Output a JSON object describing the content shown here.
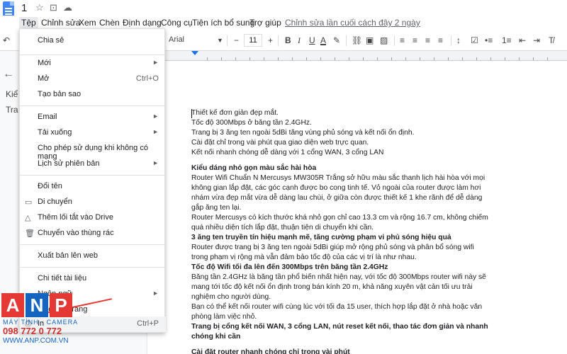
{
  "title_bar": {
    "doc_title": "1",
    "icons": [
      "star-icon",
      "move-to-folder-icon",
      "cloud-status-icon"
    ]
  },
  "menubar": {
    "items": [
      "Tệp",
      "Chỉnh sửa",
      "Xem",
      "Chèn",
      "Định dạng",
      "Công cụ",
      "Tiện ích bổ sung",
      "Trợ giúp"
    ],
    "last_edit": "Chỉnh sửa lần cuối cách đây 2 ngày"
  },
  "toolbar": {
    "font": "Arial",
    "font_size": "11",
    "minus": "−",
    "plus": "+",
    "bold": "B",
    "italic": "I",
    "underline": "U",
    "text_color": "A"
  },
  "outline": {
    "back": "←",
    "lines": [
      "Kiể",
      "Tra"
    ]
  },
  "file_menu": {
    "items": [
      {
        "label": "Chia sẻ"
      },
      {
        "label": "Mới",
        "arrow": "►"
      },
      {
        "label": "Mở",
        "shortcut": "Ctrl+O"
      },
      {
        "label": "Tạo bản sao"
      },
      {
        "label": "Email",
        "arrow": "►"
      },
      {
        "label": "Tải xuống",
        "arrow": "►"
      },
      {
        "label": "Cho phép sử dụng khi không có mạng"
      },
      {
        "label": "Lịch sử phiên bản",
        "arrow": "►"
      },
      {
        "label": "Đổi tên"
      },
      {
        "label": "Di chuyển"
      },
      {
        "label": "Thêm lối tắt vào Drive"
      },
      {
        "label": "Chuyển vào thùng rác"
      },
      {
        "label": "Xuất bản lên web"
      },
      {
        "label": "Chi tiết tài liệu"
      },
      {
        "label": "Ngôn ngữ",
        "arrow": "►"
      },
      {
        "label": "Thiết lập trang"
      },
      {
        "label": "In",
        "shortcut": "Ctrl+P"
      }
    ]
  },
  "document": {
    "lines": [
      "Thiết kế đơn giản đẹp mắt.",
      "Tốc độ 300Mbps ở băng tần 2.4GHz.",
      "Trang bị 3 ăng ten ngoài 5dBi tăng vùng phủ sóng và kết nối ổn định.",
      "Cài đặt chỉ trong vài phút qua giao diện web trực quan.",
      "Kết nối nhanh chóng dễ dàng với 1 cổng WAN, 3 cổng LAN",
      "Kiểu dáng nhỏ gọn màu sắc hài hòa",
      "Router Wifi Chuẩn N Mercusys MW305R Trắng sở hữu màu sắc thanh lịch hài hòa với mọi",
      "không gian lắp đặt, các góc cạnh được bo cong tinh tế. Vỏ ngoài của router được làm hơi",
      "nhám vừa đẹp mắt vừa dễ dàng lau chùi, ở giữa còn được thiết kế 1 khe rãnh để dễ dàng",
      "gắp ăng ten lại.",
      "Router Mercusys có kích thước khá nhỏ gọn chỉ cao 13.3 cm và rộng 16.7 cm, không chiếm",
      "quá nhiều diện tích lắp đặt, thuận tiện di chuyển khi cần.",
      "3 ăng ten truyền tín hiệu mạnh mẽ, tăng cường phạm vi phủ sóng hiệu quả",
      "Router được trang bị 3 ăng ten ngoài 5dBi giúp mở rộng phủ sóng và phân bổ sóng wifi",
      "trong phạm vị rộng mà vẫn đảm bảo tốc độ của các vị trí là như nhau.",
      "Tốc độ Wifi tối đa lên đến 300Mbps trên băng tần 2.4GHz",
      "Băng tần 2.4GHz là băng tần phổ biến nhất hiện nay, với tốc độ 300Mbps router wifi này sẽ",
      "mang tới tốc độ kết nối ổn định trong bán kính 20 m, khả năng xuyên vật cản tối ưu trải",
      "nghiệm cho người dùng.",
      "Bạn có thể kết nối router wifi cùng lúc với tối đa 15 user, thích hợp lắp đặt ở nhà hoặc văn",
      "phòng làm việc nhỏ.",
      "Trang bị cổng kết nối WAN, 3 cổng LAN, nút reset kết nối, thao tác đơn giản và nhanh",
      "chóng khi cần",
      "Cài đặt router nhanh chóng chỉ trong vài phút"
    ]
  },
  "watermark": {
    "letters": [
      "A",
      "N",
      "P"
    ],
    "slogan": "MÁY TÍNH · CAMERA",
    "phone": "098 772 0 772",
    "site": "WWW.ANP.COM.VN"
  },
  "colors": {
    "accent_blue": "#1a73e8",
    "anp_red": "#e53935",
    "anp_blue": "#1565c0"
  }
}
